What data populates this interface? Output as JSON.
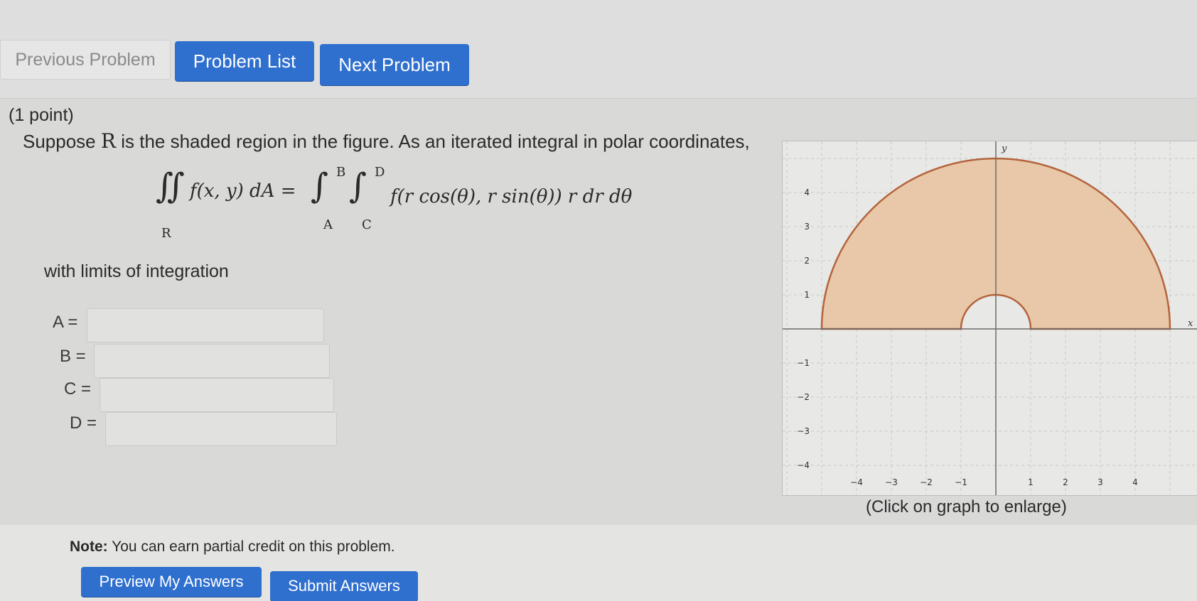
{
  "nav": {
    "previous": "Previous Problem",
    "list": "Problem List",
    "next": "Next Problem"
  },
  "problem": {
    "points": "(1 point)",
    "prompt_before": "Suppose",
    "region_var": "R",
    "prompt_after": "is the shaded region in the figure. As an iterated integral in polar coordinates,",
    "formula": {
      "lhs_integrand": "f(x, y) dA =",
      "region": "R",
      "limit_B": "B",
      "limit_A": "A",
      "limit_D": "D",
      "limit_C": "C",
      "rhs_integrand": "f(r cos(θ), r sin(θ)) r dr dθ"
    },
    "limits_text": "with limits of integration",
    "fields": [
      {
        "label": "A =",
        "value": ""
      },
      {
        "label": "B =",
        "value": ""
      },
      {
        "label": "C =",
        "value": ""
      },
      {
        "label": "D =",
        "value": ""
      }
    ]
  },
  "graph": {
    "x_ticks": [
      "−4",
      "−3",
      "−2",
      "−1",
      "1",
      "2",
      "3",
      "4"
    ],
    "y_ticks": [
      "4",
      "3",
      "2",
      "1",
      "−1",
      "−2",
      "−3",
      "−4"
    ],
    "x_axis_label": "x",
    "y_axis_label": "y",
    "outer_radius": 5,
    "inner_radius": 1,
    "fill_color": "#e8c8a8",
    "stroke_color": "#b4643c",
    "caption": "(Click on graph to enlarge)"
  },
  "note": {
    "bold": "Note:",
    "text": "You can earn partial credit on this problem."
  },
  "actions": {
    "preview": "Preview My Answers",
    "submit": "Submit Answers"
  }
}
